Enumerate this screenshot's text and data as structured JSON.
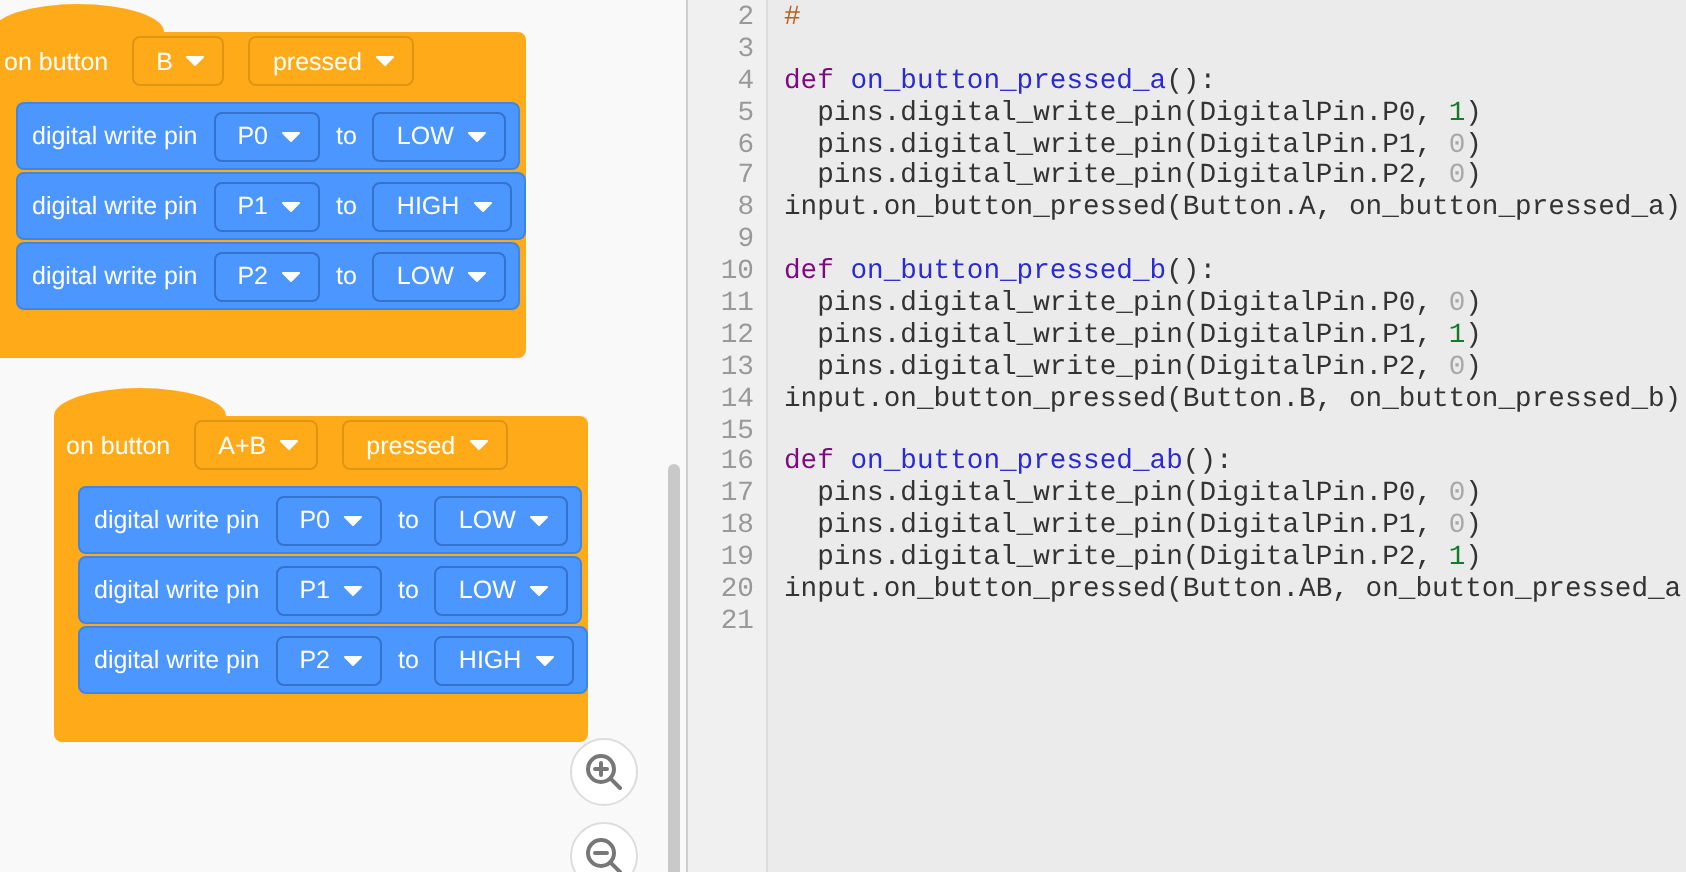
{
  "workspace": {
    "blocks": [
      {
        "kind": "event",
        "label": "on button",
        "button": "B",
        "action": "pressed",
        "statements": [
          {
            "label": "digital write pin",
            "pin": "P0",
            "joiner": "to",
            "value": "LOW"
          },
          {
            "label": "digital write pin",
            "pin": "P1",
            "joiner": "to",
            "value": "HIGH"
          },
          {
            "label": "digital write pin",
            "pin": "P2",
            "joiner": "to",
            "value": "LOW"
          }
        ]
      },
      {
        "kind": "event",
        "label": "on button",
        "button": "A+B",
        "action": "pressed",
        "statements": [
          {
            "label": "digital write pin",
            "pin": "P0",
            "joiner": "to",
            "value": "LOW"
          },
          {
            "label": "digital write pin",
            "pin": "P1",
            "joiner": "to",
            "value": "LOW"
          },
          {
            "label": "digital write pin",
            "pin": "P2",
            "joiner": "to",
            "value": "HIGH"
          }
        ]
      }
    ]
  },
  "editor": {
    "lines": [
      {
        "number": "2",
        "tokens": [
          {
            "kind": "comment",
            "text": "#"
          }
        ]
      },
      {
        "number": "3"
      },
      {
        "number": "4",
        "tokens": [
          {
            "kind": "keyword",
            "text": "def "
          },
          {
            "kind": "function",
            "text": "on_button_pressed_a"
          },
          {
            "kind": "plain",
            "text": "():"
          }
        ]
      },
      {
        "number": "5",
        "tokens": [
          {
            "kind": "plain",
            "text": "  pins.digital_write_pin(DigitalPin.P0, "
          },
          {
            "kind": "one",
            "text": "1"
          },
          {
            "kind": "plain",
            "text": ")"
          }
        ]
      },
      {
        "number": "6",
        "tokens": [
          {
            "kind": "plain",
            "text": "  pins.digital_write_pin(DigitalPin.P1, "
          },
          {
            "kind": "zero",
            "text": "0"
          },
          {
            "kind": "plain",
            "text": ")"
          }
        ]
      },
      {
        "number": "7",
        "tokens": [
          {
            "kind": "plain",
            "text": "  pins.digital_write_pin(DigitalPin.P2, "
          },
          {
            "kind": "zero",
            "text": "0"
          },
          {
            "kind": "plain",
            "text": ")"
          }
        ]
      },
      {
        "number": "8",
        "tokens": [
          {
            "kind": "plain",
            "text": "input.on_button_pressed(Button.A, on_button_pressed_a)"
          }
        ]
      },
      {
        "number": "9"
      },
      {
        "number": "10",
        "tokens": [
          {
            "kind": "keyword",
            "text": "def "
          },
          {
            "kind": "function",
            "text": "on_button_pressed_b"
          },
          {
            "kind": "plain",
            "text": "():"
          }
        ]
      },
      {
        "number": "11",
        "tokens": [
          {
            "kind": "plain",
            "text": "  pins.digital_write_pin(DigitalPin.P0, "
          },
          {
            "kind": "zero",
            "text": "0"
          },
          {
            "kind": "plain",
            "text": ")"
          }
        ]
      },
      {
        "number": "12",
        "tokens": [
          {
            "kind": "plain",
            "text": "  pins.digital_write_pin(DigitalPin.P1, "
          },
          {
            "kind": "one",
            "text": "1"
          },
          {
            "kind": "plain",
            "text": ")"
          }
        ]
      },
      {
        "number": "13",
        "tokens": [
          {
            "kind": "plain",
            "text": "  pins.digital_write_pin(DigitalPin.P2, "
          },
          {
            "kind": "zero",
            "text": "0"
          },
          {
            "kind": "plain",
            "text": ")"
          }
        ]
      },
      {
        "number": "14",
        "tokens": [
          {
            "kind": "plain",
            "text": "input.on_button_pressed(Button.B, on_button_pressed_b)"
          }
        ]
      },
      {
        "number": "15"
      },
      {
        "number": "16",
        "tokens": [
          {
            "kind": "keyword",
            "text": "def "
          },
          {
            "kind": "function",
            "text": "on_button_pressed_ab"
          },
          {
            "kind": "plain",
            "text": "():"
          }
        ]
      },
      {
        "number": "17",
        "tokens": [
          {
            "kind": "plain",
            "text": "  pins.digital_write_pin(DigitalPin.P0, "
          },
          {
            "kind": "zero",
            "text": "0"
          },
          {
            "kind": "plain",
            "text": ")"
          }
        ]
      },
      {
        "number": "18",
        "tokens": [
          {
            "kind": "plain",
            "text": "  pins.digital_write_pin(DigitalPin.P1, "
          },
          {
            "kind": "zero",
            "text": "0"
          },
          {
            "kind": "plain",
            "text": ")"
          }
        ]
      },
      {
        "number": "19",
        "tokens": [
          {
            "kind": "plain",
            "text": "  pins.digital_write_pin(DigitalPin.P2, "
          },
          {
            "kind": "one",
            "text": "1"
          },
          {
            "kind": "plain",
            "text": ")"
          }
        ]
      },
      {
        "number": "20",
        "tokens": [
          {
            "kind": "plain",
            "text": "input.on_button_pressed(Button.AB, on_button_pressed_a"
          }
        ]
      },
      {
        "number": "21"
      }
    ]
  }
}
